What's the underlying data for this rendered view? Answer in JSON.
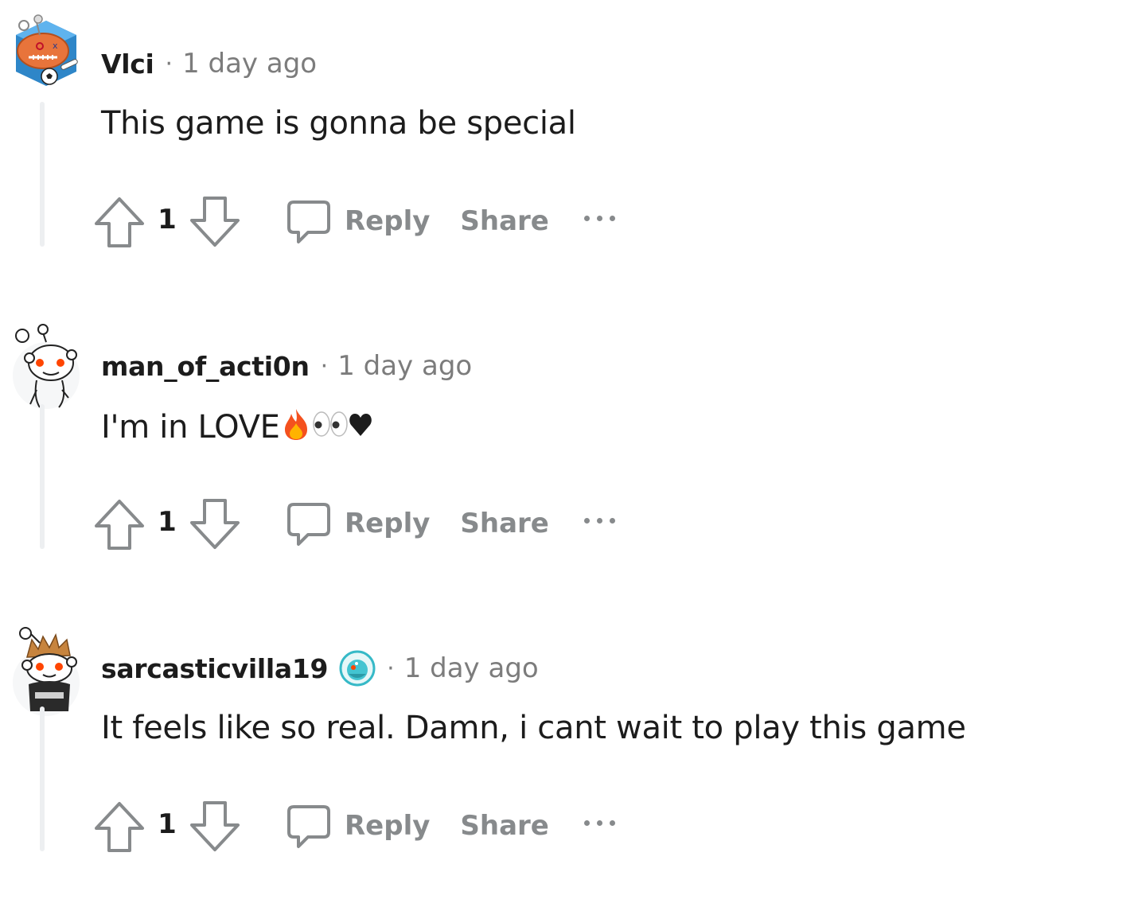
{
  "comments": [
    {
      "username": "Vlci",
      "separator": "·",
      "time": "1 day ago",
      "body": "This game is gonna be special",
      "score": "1",
      "reply_label": "Reply",
      "share_label": "Share",
      "avatar_icon": "football-snoo-avatar-icon"
    },
    {
      "username": "man_of_acti0n",
      "separator": "·",
      "time": "1 day ago",
      "body": "I'm in LOVE",
      "body_emojis": [
        "fire-emoji",
        "eyes-emoji",
        "heart-emoji"
      ],
      "score": "1",
      "reply_label": "Reply",
      "share_label": "Share",
      "avatar_icon": "default-snoo-avatar-icon"
    },
    {
      "username": "sarcasticvilla19",
      "separator": "·",
      "time": "1 day ago",
      "body": "It feels like so real. Damn, i cant wait to play this game",
      "score": "1",
      "reply_label": "Reply",
      "share_label": "Share",
      "avatar_icon": "spiky-hair-snoo-avatar-icon",
      "flair_icon": "snoo-flair-badge-icon"
    }
  ],
  "colors": {
    "text": "#1c1c1c",
    "muted": "#7c7c7c",
    "action": "#878a8c",
    "thread_line": "#edeff1",
    "snoo_orange": "#ff4500"
  }
}
